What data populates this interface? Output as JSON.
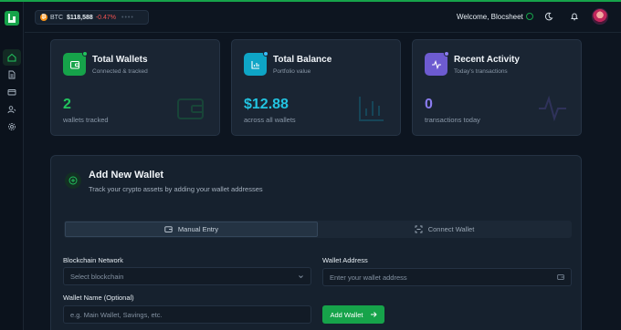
{
  "ticker": {
    "symbol": "BTC",
    "coin_glyph": "₿",
    "price": "$118,588",
    "change": "-0.47%",
    "dots": "••••"
  },
  "header": {
    "welcome": "Welcome, Blocsheet"
  },
  "cards": [
    {
      "title": "Total Wallets",
      "subtitle": "Connected & tracked",
      "value": "2",
      "label": "wallets tracked",
      "accent": "#16a34a",
      "value_color": "#22c55e"
    },
    {
      "title": "Total Balance",
      "subtitle": "Portfolio value",
      "value": "$12.88",
      "label": "across all wallets",
      "accent": "#0ea5c6",
      "value_color": "#22c3e0"
    },
    {
      "title": "Recent Activity",
      "subtitle": "Today's transactions",
      "value": "0",
      "label": "transactions today",
      "accent": "#6d5bd0",
      "value_color": "#8b7cf0"
    }
  ],
  "add_wallet": {
    "title": "Add New Wallet",
    "subtitle": "Track your crypto assets by adding your wallet addresses",
    "tabs": [
      "Manual Entry",
      "Connect Wallet"
    ],
    "network_label": "Blockchain Network",
    "network_value": "Select blockchain",
    "address_label": "Wallet Address",
    "address_placeholder": "Enter your wallet address",
    "name_label": "Wallet Name (Optional)",
    "name_placeholder": "e.g. Main Wallet, Savings, etc.",
    "submit_label": "Add Wallet"
  }
}
